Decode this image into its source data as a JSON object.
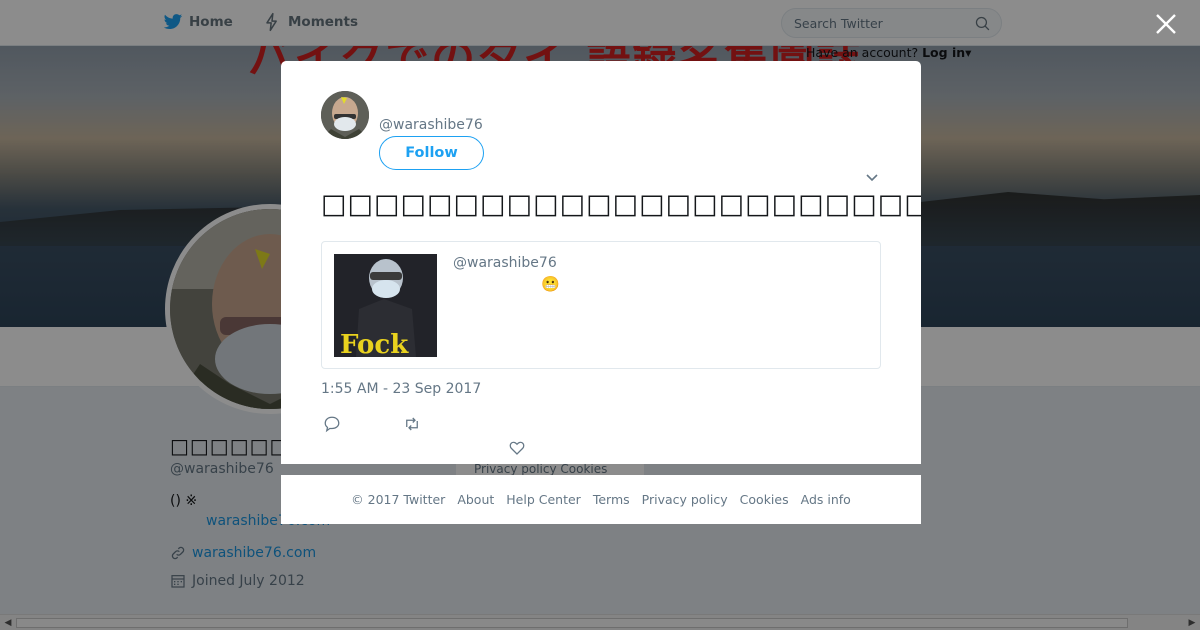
{
  "topbar": {
    "home_label": "Home",
    "moments_label": "Moments",
    "search_placeholder": "Search Twitter",
    "login_prompt": "Have an account?",
    "login_label": "Log in",
    "login_caret": "▾"
  },
  "banner": {
    "overlay_text": "バイクでの夕イ 語録名集園誌"
  },
  "profile": {
    "display_name": "□□□□□□□□",
    "handle": "@warashibe76",
    "bio_line": "() ※",
    "bio_link": "warashibe76.com",
    "website": "warashibe76.com",
    "joined": "Joined July 2012"
  },
  "underlay_card_text": "Privacy policy  Cookies",
  "modal": {
    "author_handle": "@warashibe76",
    "follow_label": "Follow",
    "tweet_text": "□□□□□□□□□□□□□□□□□□□□□□□□□□□□□□□□□□□□□□□□□□□□□□□□□□ · (□)□□□□□□□□ w",
    "quoted": {
      "handle": "@warashibe76",
      "emoji": "😬",
      "image_text": "Fock"
    },
    "timestamp": "1:55 AM - 23 Sep 2017"
  },
  "footer": {
    "links": [
      "© 2017 Twitter",
      "About",
      "Help Center",
      "Terms",
      "Privacy policy",
      "Cookies",
      "Ads info"
    ]
  },
  "colors": {
    "brand": "#1da1f2",
    "link": "#1b95e0",
    "muted": "#657786",
    "text": "#14171a",
    "banner_text": "#d21f1f"
  },
  "icons": [
    "twitter-bird-icon",
    "lightning-icon",
    "search-icon",
    "close-icon",
    "chevron-down-icon",
    "reply-icon",
    "retweet-icon",
    "like-icon",
    "link-icon",
    "calendar-icon"
  ]
}
